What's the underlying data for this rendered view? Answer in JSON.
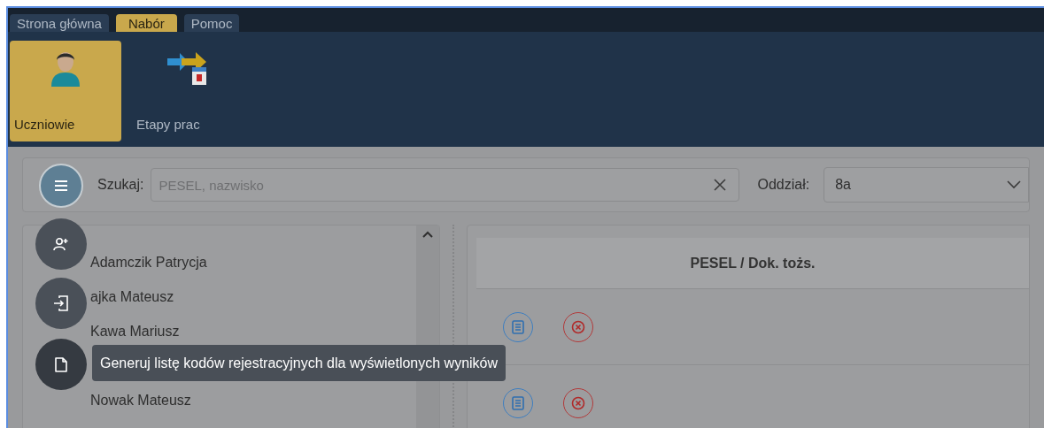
{
  "tabs": [
    {
      "label": "Strona główna",
      "selected": false
    },
    {
      "label": "Nabór",
      "selected": true
    },
    {
      "label": "Pomoc",
      "selected": false
    }
  ],
  "ribbon": [
    {
      "label": "Uczniowie",
      "selected": true,
      "kind": "student"
    },
    {
      "label": "Etapy prac",
      "selected": false,
      "kind": "stages"
    }
  ],
  "search": {
    "label": "Szukaj:",
    "placeholder": "PESEL, nazwisko"
  },
  "class_filter": {
    "label": "Oddział:",
    "value": "8a"
  },
  "students": [
    "Adamczik Patrycja",
    "ajka Mateusz",
    "Kawa Mariusz",
    "Nowak Mateusz"
  ],
  "fab_actions": [
    {
      "kind": "menu"
    },
    {
      "kind": "add-person"
    },
    {
      "kind": "import"
    },
    {
      "kind": "document"
    }
  ],
  "tooltip": "Generuj listę kodów rejestracyjnych dla wyświetlonych wyników",
  "table": {
    "column": "PESEL / Dok. tożs.",
    "rows": [
      {
        "details_button": true,
        "remove_button": true
      },
      {
        "details_button": true,
        "remove_button": true
      }
    ]
  }
}
